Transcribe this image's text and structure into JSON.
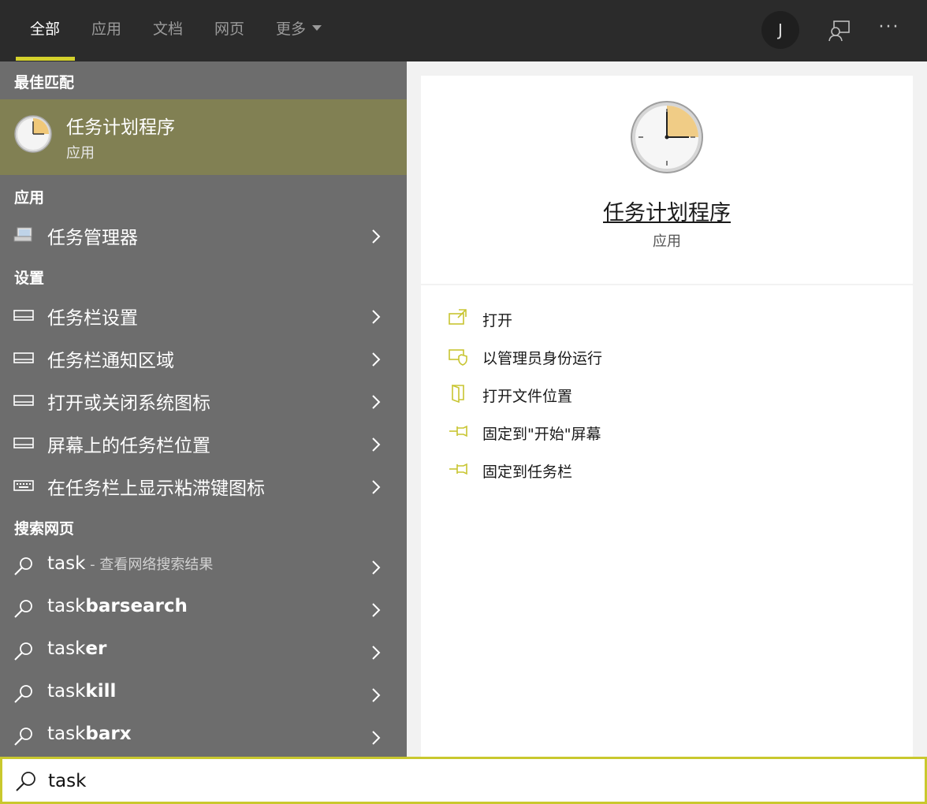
{
  "tabs": [
    {
      "label": "全部"
    },
    {
      "label": "应用"
    },
    {
      "label": "文档"
    },
    {
      "label": "网页"
    },
    {
      "label": "更多"
    }
  ],
  "account": {
    "initial": "J"
  },
  "more_options": "···",
  "sections": {
    "best_match": "最佳匹配",
    "apps": "应用",
    "settings": "设置",
    "web": "搜索网页"
  },
  "best_match": {
    "title": "任务计划程序",
    "subtitle": "应用",
    "icon": "clock-icon"
  },
  "apps": [
    {
      "label": "任务管理器",
      "icon": "task-manager-icon"
    }
  ],
  "settings": [
    {
      "label": "任务栏设置",
      "icon": "taskbar-icon"
    },
    {
      "label": "任务栏通知区域",
      "icon": "taskbar-icon"
    },
    {
      "label": "打开或关闭系统图标",
      "icon": "taskbar-icon"
    },
    {
      "label": "屏幕上的任务栏位置",
      "icon": "taskbar-icon"
    },
    {
      "label": "在任务栏上显示粘滞键图标",
      "icon": "keyboard-icon"
    }
  ],
  "web_results": [
    {
      "prefix": "task",
      "suffix": "",
      "note": " - 查看网络搜索结果"
    },
    {
      "prefix": "task",
      "suffix": "barsearch",
      "note": ""
    },
    {
      "prefix": "task",
      "suffix": "er",
      "note": ""
    },
    {
      "prefix": "task",
      "suffix": "kill",
      "note": ""
    },
    {
      "prefix": "task",
      "suffix": "barx",
      "note": ""
    }
  ],
  "preview": {
    "title": "任务计划程序",
    "subtitle": "应用"
  },
  "actions": [
    {
      "label": "打开",
      "icon": "open-icon"
    },
    {
      "label": "以管理员身份运行",
      "icon": "run-as-admin-icon"
    },
    {
      "label": "打开文件位置",
      "icon": "file-location-icon"
    },
    {
      "label": "固定到\"开始\"屏幕",
      "icon": "pin-icon"
    },
    {
      "label": "固定到任务栏",
      "icon": "pin-icon"
    }
  ],
  "search": {
    "value": "task"
  },
  "colors": {
    "accent": "#d4d12c",
    "left_panel": "#6d6d6d",
    "selected": "#818053",
    "topbar": "#2b2b2b"
  }
}
